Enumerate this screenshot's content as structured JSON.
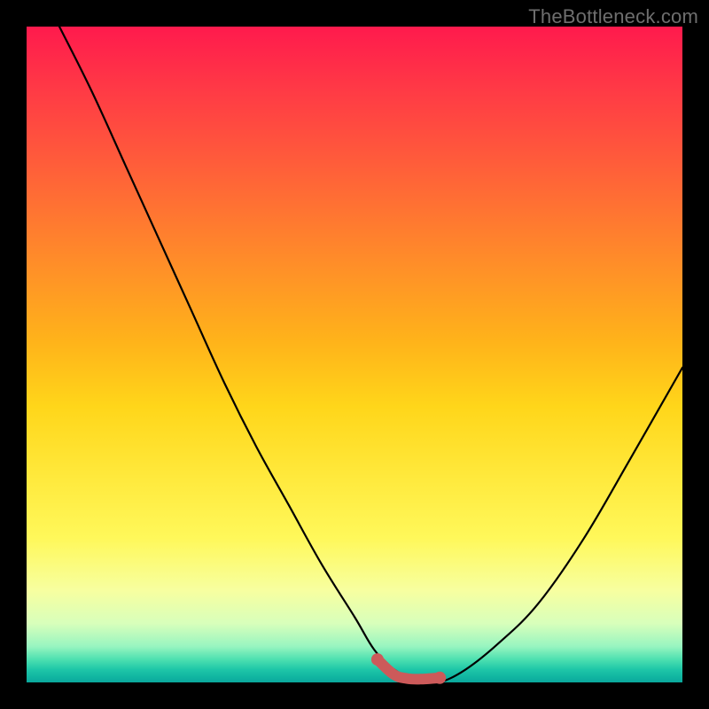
{
  "watermark": "TheBottleneck.com",
  "colors": {
    "background_frame": "#000000",
    "curve_stroke": "#000000",
    "highlight_stroke": "#cc5a5a",
    "gradient_top": "#ff1a4d",
    "gradient_bottom": "#0aa79c"
  },
  "chart_data": {
    "type": "line",
    "title": "",
    "xlabel": "",
    "ylabel": "",
    "xlim": [
      0,
      100
    ],
    "ylim": [
      0,
      100
    ],
    "grid": false,
    "legend": false,
    "series": [
      {
        "name": "bottleneck-curve",
        "x": [
          5,
          10,
          15,
          20,
          25,
          30,
          35,
          40,
          45,
          50,
          53,
          56,
          60,
          63,
          67,
          72,
          78,
          85,
          92,
          100
        ],
        "y": [
          100,
          90,
          79,
          68,
          57,
          46,
          36,
          27,
          18,
          10,
          5,
          2,
          0,
          0,
          2,
          6,
          12,
          22,
          34,
          48
        ]
      }
    ],
    "highlight": {
      "name": "optimal-range-marker",
      "x": [
        53.5,
        56,
        58,
        60,
        63
      ],
      "y": [
        3.5,
        1.2,
        0.6,
        0.5,
        0.7
      ]
    }
  }
}
